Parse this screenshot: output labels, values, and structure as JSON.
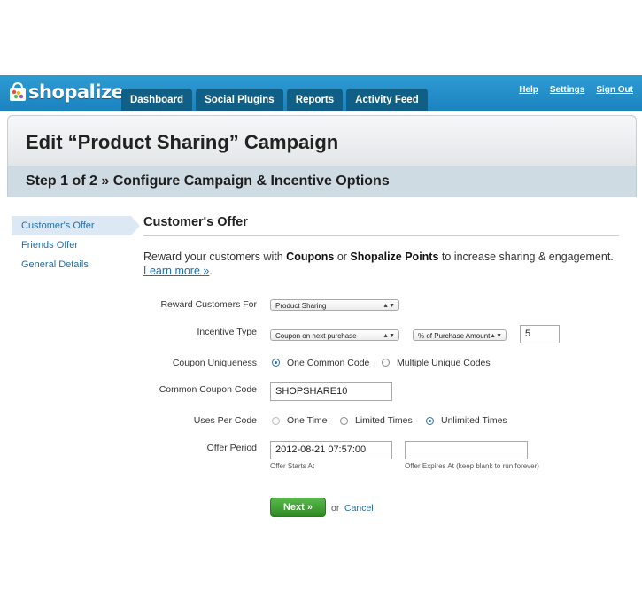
{
  "brand": {
    "logo_text": "shopalize"
  },
  "nav_tabs": [
    {
      "label": "Dashboard"
    },
    {
      "label": "Social Plugins"
    },
    {
      "label": "Reports"
    },
    {
      "label": "Activity Feed"
    }
  ],
  "top_links": [
    {
      "label": "Help"
    },
    {
      "label": "Settings"
    },
    {
      "label": "Sign Out"
    }
  ],
  "page_title": "Edit “Product Sharing” Campaign",
  "step_title": "Step 1 of 2 » Configure Campaign & Incentive Options",
  "sidebar": {
    "items": [
      {
        "label": "Customer's Offer",
        "active": true
      },
      {
        "label": "Friends Offer",
        "active": false
      },
      {
        "label": "General Details",
        "active": false
      }
    ]
  },
  "section": {
    "title": "Customer's Offer",
    "intro_1": "Reward your customers with ",
    "intro_coupons": "Coupons",
    "intro_2": " or ",
    "intro_points": "Shopalize Points",
    "intro_3": " to increase sharing & engagement.",
    "learn_more": "Learn more »",
    "learn_more_after": "."
  },
  "form": {
    "reward_for": {
      "label": "Reward Customers For",
      "value": "Product Sharing"
    },
    "incentive_type": {
      "label": "Incentive Type",
      "value": "Coupon on next purchase",
      "unit": "% of Purchase Amount",
      "amount": "5"
    },
    "coupon_uniqueness": {
      "label": "Coupon Uniqueness",
      "options": [
        "One Common Code",
        "Multiple Unique Codes"
      ],
      "selected": "One Common Code"
    },
    "common_code": {
      "label": "Common Coupon Code",
      "value": "SHOPSHARE10"
    },
    "uses_per_code": {
      "label": "Uses Per Code",
      "options": [
        "One Time",
        "Limited Times",
        "Unlimited Times"
      ],
      "selected": "Unlimited Times"
    },
    "offer_period": {
      "label": "Offer Period",
      "start_value": "2012-08-21 07:57:00",
      "end_value": "",
      "start_hint": "Offer Starts At",
      "end_hint": "Offer Expires At (keep blank to run forever)"
    }
  },
  "actions": {
    "next_label": "Next »",
    "or_text": "or",
    "cancel_label": "Cancel"
  },
  "colors": {
    "topbar": "#1b83be",
    "tab": "#0f5f86",
    "link": "#1f6fa8",
    "next_button": "#2e8b24",
    "step_bar": "#cfdbe3"
  }
}
